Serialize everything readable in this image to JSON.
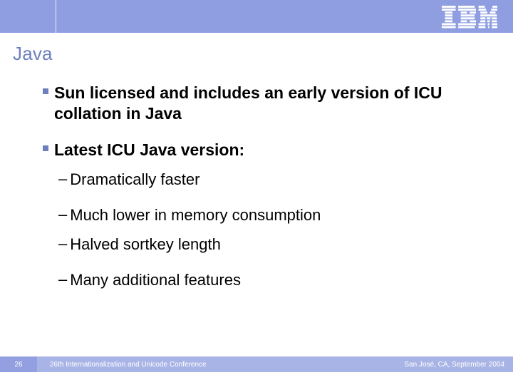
{
  "title": "Java",
  "bullets": [
    {
      "text": "Sun licensed and includes an early version of ICU collation in Java",
      "children": []
    },
    {
      "text": "Latest ICU Java version:",
      "children": [
        "Dramatically faster",
        "Much lower in memory consumption",
        "Halved sortkey length",
        "Many additional features"
      ]
    }
  ],
  "footer": {
    "page": "26",
    "left": "26th Internationalization and Unicode Conference",
    "right": "San José, CA, September 2004"
  },
  "logo": {
    "name": "IBM"
  }
}
